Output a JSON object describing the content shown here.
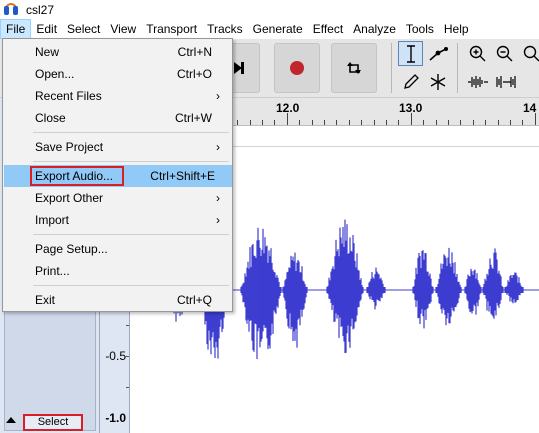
{
  "window": {
    "title": "csl27"
  },
  "menubar": {
    "items": [
      "File",
      "Edit",
      "Select",
      "View",
      "Transport",
      "Tracks",
      "Generate",
      "Effect",
      "Analyze",
      "Tools",
      "Help"
    ],
    "active": "File"
  },
  "file_menu": {
    "items": [
      {
        "label": "New",
        "shortcut": "Ctrl+N"
      },
      {
        "label": "Open...",
        "shortcut": "Ctrl+O"
      },
      {
        "label": "Recent Files",
        "submenu": true
      },
      {
        "label": "Close",
        "shortcut": "Ctrl+W"
      },
      {
        "label": "Save Project",
        "submenu": true
      },
      {
        "label": "Export Audio...",
        "shortcut": "Ctrl+Shift+E",
        "highlighted": true
      },
      {
        "label": "Export Other",
        "submenu": true
      },
      {
        "label": "Import",
        "submenu": true
      },
      {
        "label": "Page Setup..."
      },
      {
        "label": "Print..."
      },
      {
        "label": "Exit",
        "shortcut": "Ctrl+Q"
      }
    ],
    "submenu_arrow": "›"
  },
  "toolbar": {
    "transport_buttons": [
      "skip-to-end-icon",
      "record-icon",
      "loop-icon"
    ],
    "tools": [
      "selection-tool-icon",
      "envelope-tool-icon",
      "draw-tool-icon",
      "multi-tool-icon"
    ],
    "zoom": [
      "zoom-in-icon",
      "zoom-out-icon",
      "fit-selection-icon",
      "trim-icon",
      "silence-icon"
    ]
  },
  "ruler": {
    "labels": [
      "12.0",
      "13.0",
      "14"
    ]
  },
  "track": {
    "scale_labels": [
      "-0.5",
      "-1.0"
    ],
    "select_label": "Select",
    "wave_color": "#3d3dd0"
  },
  "colors": {
    "highlight": "#91c9f7",
    "annotation": "#d91e2a",
    "record": "#c0262d"
  }
}
